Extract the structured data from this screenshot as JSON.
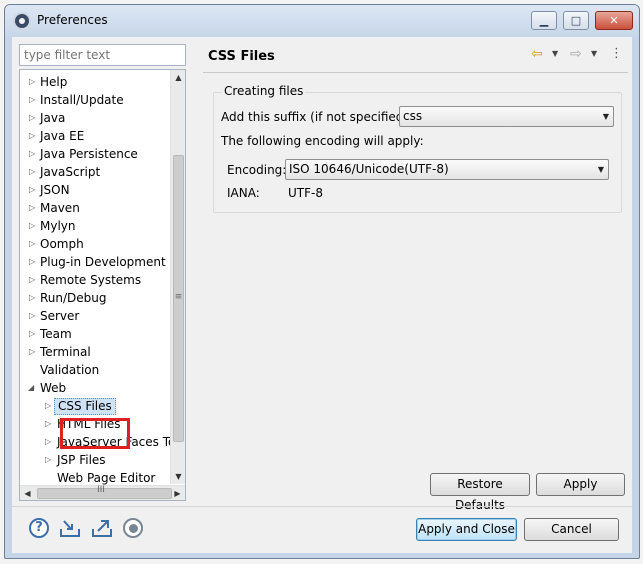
{
  "window": {
    "title": "Preferences"
  },
  "filter": {
    "placeholder": "type filter text"
  },
  "tree": {
    "items": [
      {
        "label": "Help"
      },
      {
        "label": "Install/Update"
      },
      {
        "label": "Java"
      },
      {
        "label": "Java EE"
      },
      {
        "label": "Java Persistence"
      },
      {
        "label": "JavaScript"
      },
      {
        "label": "JSON"
      },
      {
        "label": "Maven"
      },
      {
        "label": "Mylyn"
      },
      {
        "label": "Oomph"
      },
      {
        "label": "Plug-in Development"
      },
      {
        "label": "Remote Systems"
      },
      {
        "label": "Run/Debug"
      },
      {
        "label": "Server"
      },
      {
        "label": "Team"
      },
      {
        "label": "Terminal"
      },
      {
        "label": "Validation"
      },
      {
        "label": "Web"
      },
      {
        "label": "CSS Files"
      },
      {
        "label": "HTML Files"
      },
      {
        "label": "JavaServer Faces Too"
      },
      {
        "label": "JSP Files"
      },
      {
        "label": "Web Page Editor"
      }
    ],
    "selected": "CSS Files",
    "hscroll_grip": "III",
    "vscroll_grip": "≡"
  },
  "page": {
    "title": "CSS Files",
    "group_title": "Creating files",
    "suffix_label": "Add this suffix (if not specified):",
    "suffix_value": "css",
    "encoding_note": "The following encoding will apply:",
    "encoding_label": "Encoding:",
    "encoding_value": "ISO 10646/Unicode(UTF-8)",
    "iana_label": "IANA:",
    "iana_value": "UTF-8"
  },
  "buttons": {
    "restore_defaults": "Restore Defaults",
    "apply": "Apply",
    "apply_and_close": "Apply and Close",
    "cancel": "Cancel"
  },
  "icons": {
    "nav_back": "back-arrow-icon",
    "nav_forward": "forward-arrow-icon",
    "view_menu": "view-menu-icon",
    "help": "help-icon",
    "import": "import-icon",
    "export": "export-icon",
    "record": "record-icon"
  },
  "colors": {
    "highlight_box": "#e02020",
    "selection": "#cfe3f7"
  }
}
